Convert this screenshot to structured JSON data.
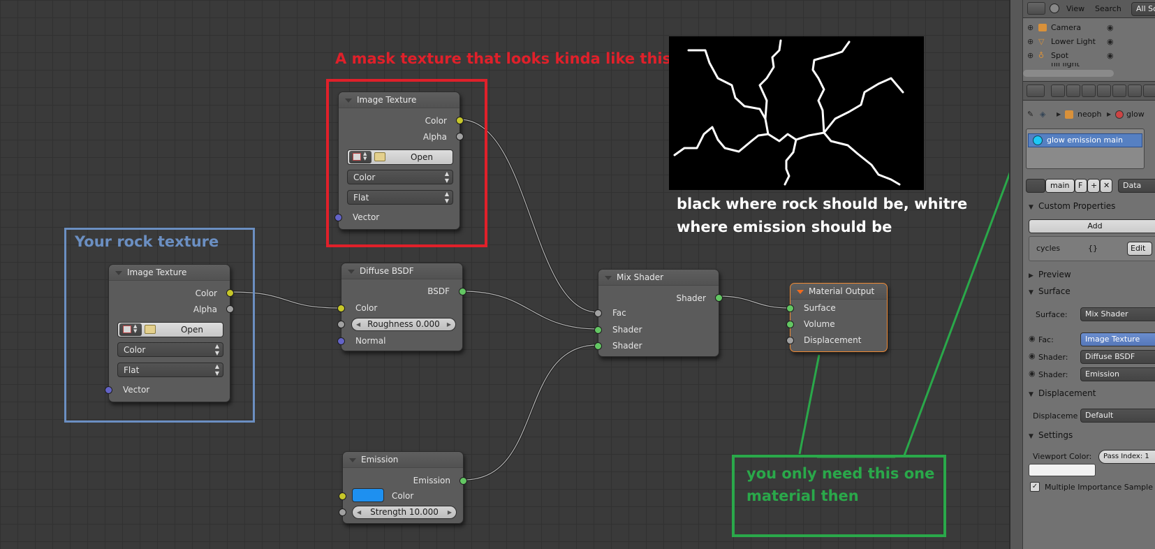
{
  "node_editor": {
    "nodes": {
      "mask_image_texture": {
        "title": "Image Texture",
        "out_color": "Color",
        "out_alpha": "Alpha",
        "open_label": "Open",
        "color_space": "Color",
        "projection": "Flat",
        "in_vector": "Vector"
      },
      "rock_image_texture": {
        "title": "Image Texture",
        "out_color": "Color",
        "out_alpha": "Alpha",
        "open_label": "Open",
        "color_space": "Color",
        "projection": "Flat",
        "in_vector": "Vector"
      },
      "diffuse_bsdf": {
        "title": "Diffuse BSDF",
        "out_bsdf": "BSDF",
        "in_color": "Color",
        "roughness": "Roughness 0.000",
        "in_normal": "Normal"
      },
      "mix_shader": {
        "title": "Mix Shader",
        "out_shader": "Shader",
        "in_fac": "Fac",
        "in_shader1": "Shader",
        "in_shader2": "Shader"
      },
      "material_output": {
        "title": "Material Output",
        "in_surface": "Surface",
        "in_volume": "Volume",
        "in_displacement": "Displacement"
      },
      "emission": {
        "title": "Emission",
        "out_emission": "Emission",
        "in_color": "Color",
        "swatch_color": "#1e90f0",
        "strength": "Strength 10.000"
      }
    },
    "annotations": {
      "mask_caption": "A mask texture that looks kinda like this:",
      "rock_caption": "Your rock texture",
      "mask_desc_line1": "black where rock should be, whitre",
      "mask_desc_line2": "where emission should be",
      "material_line1": "you only need this one",
      "material_line2": "material then"
    },
    "colors": {
      "red": "#e0202a",
      "blue": "#6b8fc2",
      "green": "#2aa84a",
      "grid_bg": "#3a3a3a"
    }
  },
  "properties_panel": {
    "header": {
      "view": "View",
      "search": "Search",
      "scenes": "All Sc"
    },
    "outliner": [
      "Camera",
      "Lower Light",
      "Spot",
      "fill light"
    ],
    "breadcrumb": {
      "object": "neoph",
      "material": "glow"
    },
    "material_slot": "glow emission main",
    "datablock": {
      "name": "main",
      "fake_user": "F",
      "link": "Data"
    },
    "custom_properties": {
      "header": "Custom Properties",
      "add": "Add",
      "prop_name": "cycles",
      "prop_value": "{}",
      "edit": "Edit"
    },
    "preview_header": "Preview",
    "surface": {
      "header": "Surface",
      "surface_label": "Surface:",
      "surface_value": "Mix Shader",
      "fac_label": "Fac:",
      "fac_value": "Image Texture",
      "shader1_label": "Shader:",
      "shader1_value": "Diffuse BSDF",
      "shader2_label": "Shader:",
      "shader2_value": "Emission"
    },
    "displacement": {
      "header": "Displacement",
      "label": "Displaceme",
      "value": "Default"
    },
    "settings": {
      "header": "Settings",
      "viewport_color": "Viewport Color:",
      "pass_index": "Pass Index: 1",
      "mis": "Multiple Importance Sample"
    }
  }
}
